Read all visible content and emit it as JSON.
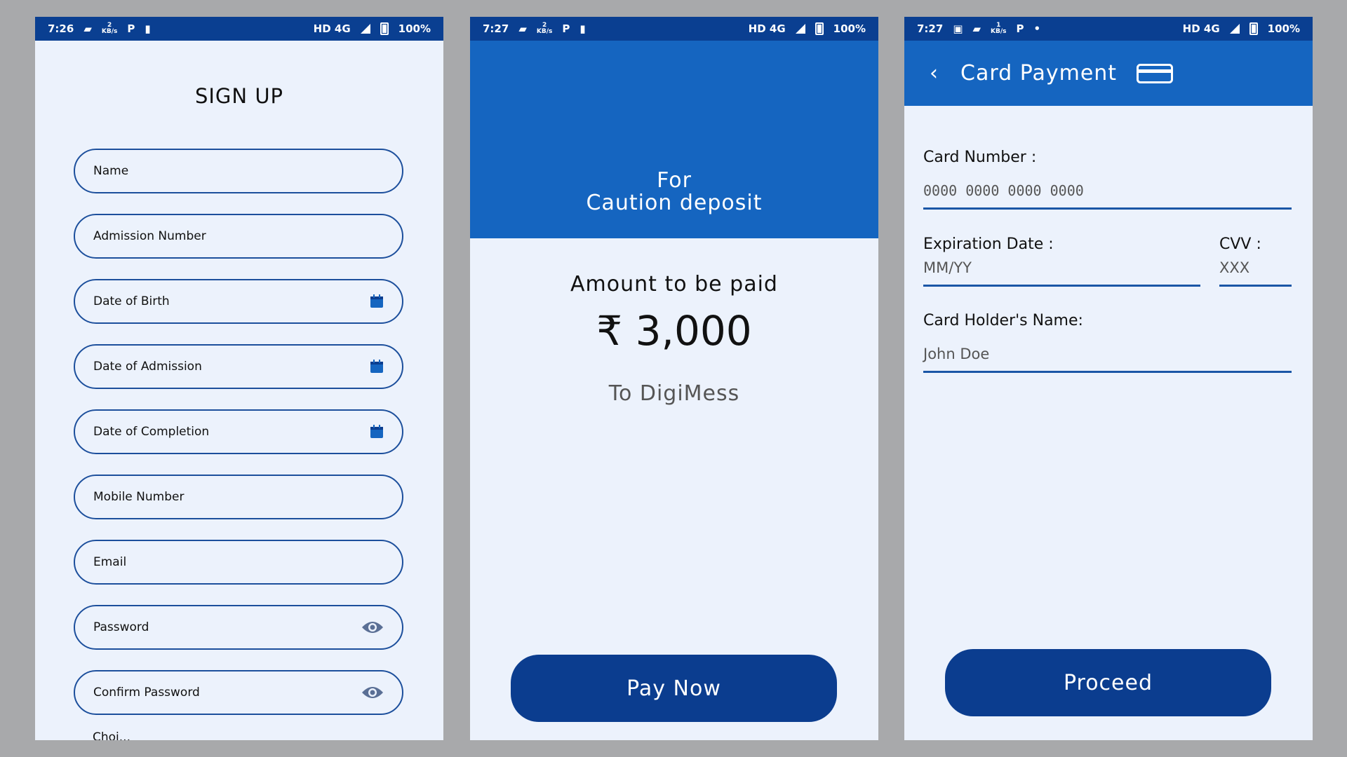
{
  "screen1": {
    "status": {
      "time": "7:26",
      "kbs_top": "2",
      "kbs_bottom": "KB/s",
      "network": "HD 4G",
      "battery": "100%"
    },
    "title": "SIGN UP",
    "fields": {
      "name": "Name",
      "admission_number": "Admission Number",
      "date_of_birth": "Date of Birth",
      "date_of_admission": "Date of Admission",
      "date_of_completion": "Date of Completion",
      "mobile_number": "Mobile Number",
      "email": "Email",
      "password": "Password",
      "confirm_password": "Confirm Password"
    },
    "cut_label": "Choi..."
  },
  "screen2": {
    "status": {
      "time": "7:27",
      "kbs_top": "2",
      "kbs_bottom": "KB/s",
      "network": "HD 4G",
      "battery": "100%"
    },
    "for_line1": "For",
    "for_line2": "Caution deposit",
    "amount_label": "Amount to be paid",
    "amount": "₹ 3,000",
    "to": "To DigiMess",
    "button": "Pay Now"
  },
  "screen3": {
    "status": {
      "time": "7:27",
      "kbs_top": "1",
      "kbs_bottom": "KB/s",
      "network": "HD 4G",
      "battery": "100%"
    },
    "title": "Card Payment",
    "card_number_label": "Card Number :",
    "card_number_placeholder": "0000 0000 0000 0000",
    "expiration_label": "Expiration Date :",
    "expiration_placeholder": "MM/YY",
    "cvv_label": "CVV :",
    "cvv_placeholder": "XXX",
    "holder_label": "Card Holder's Name:",
    "holder_placeholder": "John Doe",
    "button": "Proceed"
  },
  "colors": {
    "primary_dark": "#0b3d8f",
    "primary": "#1565c0",
    "background": "#ecf2fc"
  }
}
